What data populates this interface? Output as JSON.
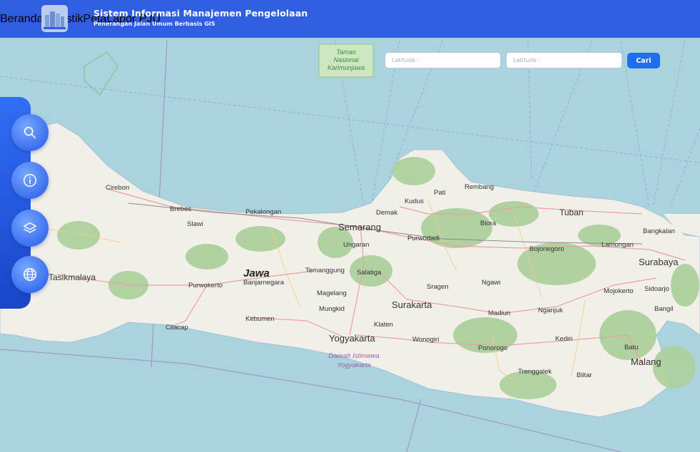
{
  "header": {
    "title": "Sistem Informasi Manajemen Pengelolaan",
    "subtitle": "Penerangan Jalan Umum Berbasis GIS",
    "nav": [
      "Beranda",
      "Statistik",
      "Peta",
      "Lapor PJU"
    ]
  },
  "search": {
    "lat_placeholder_1": "Latitude :",
    "lat_placeholder_2": "Latitude :",
    "button_label": "Cari"
  },
  "tools": [
    "search-icon",
    "info-icon",
    "layers-icon",
    "globe-icon"
  ],
  "map": {
    "park_label": [
      "Taman",
      "Nasional",
      "Karimunjawa"
    ],
    "region_label": "Jawa",
    "dy_label": [
      "Daerah Istimewa",
      "Yogyakarta"
    ],
    "cities": [
      {
        "name": "Cirebon"
      },
      {
        "name": "Brebes"
      },
      {
        "name": "Slawi"
      },
      {
        "name": "Pekalongan"
      },
      {
        "name": "Semarang"
      },
      {
        "name": "Demak"
      },
      {
        "name": "Kudus"
      },
      {
        "name": "Pati"
      },
      {
        "name": "Rembang"
      },
      {
        "name": "Tuban"
      },
      {
        "name": "Bangkalan"
      },
      {
        "name": "Lamongan"
      },
      {
        "name": "Surabaya"
      },
      {
        "name": "Blora"
      },
      {
        "name": "Purwodadi"
      },
      {
        "name": "Ungaran"
      },
      {
        "name": "Bojonegoro"
      },
      {
        "name": "Tasikmalaya"
      },
      {
        "name": "Purwokerto"
      },
      {
        "name": "Banjarnegara"
      },
      {
        "name": "Temanggung"
      },
      {
        "name": "Salatiga"
      },
      {
        "name": "Magelang"
      },
      {
        "name": "Sragen"
      },
      {
        "name": "Ngawi"
      },
      {
        "name": "Mojokerto"
      },
      {
        "name": "Sidoarjo"
      },
      {
        "name": "Mungkid"
      },
      {
        "name": "Surakarta"
      },
      {
        "name": "Madiun"
      },
      {
        "name": "Nganjuk"
      },
      {
        "name": "Bangil"
      },
      {
        "name": "Cilacap"
      },
      {
        "name": "Kebumen"
      },
      {
        "name": "Klaten"
      },
      {
        "name": "Yogyakarta"
      },
      {
        "name": "Wonogiri"
      },
      {
        "name": "Kediri"
      },
      {
        "name": "Ponorogo"
      },
      {
        "name": "Batu"
      },
      {
        "name": "Malang"
      },
      {
        "name": "Trenggalek"
      },
      {
        "name": "Blitar"
      }
    ]
  },
  "colors": {
    "header": "#2f5ee0",
    "sea": "#aad3df",
    "land": "#f2efe9",
    "forest": "#add19e",
    "accent": "#1f6ef0"
  }
}
